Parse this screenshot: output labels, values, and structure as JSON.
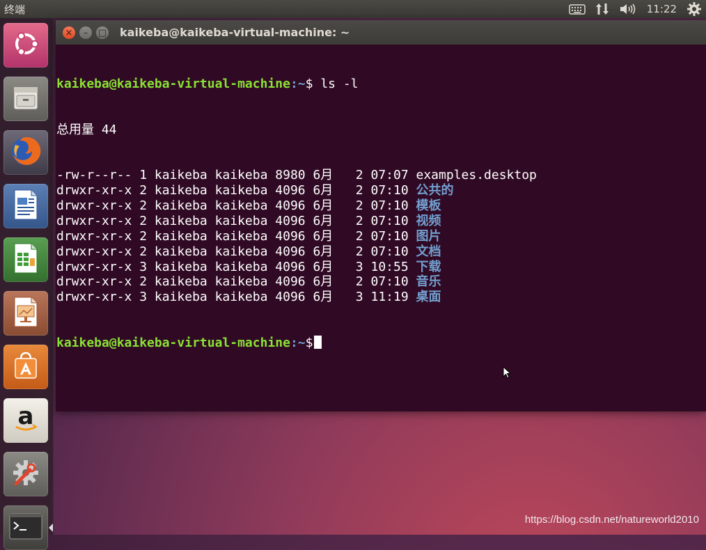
{
  "top_panel": {
    "app_title": "终端",
    "clock": "11:22",
    "icons": [
      "keyboard-icon",
      "network-arrows-icon",
      "volume-icon",
      "settings-gear-icon"
    ]
  },
  "launcher": {
    "items": [
      {
        "name": "ubuntu-dash",
        "icon": "ubuntu-logo-icon"
      },
      {
        "name": "files",
        "icon": "file-cabinet-icon"
      },
      {
        "name": "firefox",
        "icon": "firefox-icon"
      },
      {
        "name": "libreoffice-writer",
        "icon": "writer-document-icon"
      },
      {
        "name": "libreoffice-calc",
        "icon": "calc-spreadsheet-icon"
      },
      {
        "name": "libreoffice-impress",
        "icon": "impress-presentation-icon"
      },
      {
        "name": "ubuntu-software",
        "icon": "software-bag-icon"
      },
      {
        "name": "amazon",
        "icon": "amazon-icon"
      },
      {
        "name": "system-settings",
        "icon": "settings-wrench-icon"
      },
      {
        "name": "terminal",
        "icon": "terminal-icon",
        "active": true
      }
    ]
  },
  "window": {
    "title": "kaikeba@kaikeba-virtual-machine: ~"
  },
  "terminal": {
    "prompt_user_host": "kaikeba@kaikeba-virtual-machine",
    "prompt_path": ":~",
    "prompt_symbol": "$",
    "command": " ls -l",
    "total_line": "总用量 44",
    "entries": [
      {
        "meta": "-rw-r--r-- 1 kaikeba kaikeba 8980 6月   2 07:07 ",
        "name": "examples.desktop",
        "is_dir": false
      },
      {
        "meta": "drwxr-xr-x 2 kaikeba kaikeba 4096 6月   2 07:10 ",
        "name": "公共的",
        "is_dir": true
      },
      {
        "meta": "drwxr-xr-x 2 kaikeba kaikeba 4096 6月   2 07:10 ",
        "name": "模板",
        "is_dir": true
      },
      {
        "meta": "drwxr-xr-x 2 kaikeba kaikeba 4096 6月   2 07:10 ",
        "name": "视频",
        "is_dir": true
      },
      {
        "meta": "drwxr-xr-x 2 kaikeba kaikeba 4096 6月   2 07:10 ",
        "name": "图片",
        "is_dir": true
      },
      {
        "meta": "drwxr-xr-x 2 kaikeba kaikeba 4096 6月   2 07:10 ",
        "name": "文档",
        "is_dir": true
      },
      {
        "meta": "drwxr-xr-x 3 kaikeba kaikeba 4096 6月   3 10:55 ",
        "name": "下载",
        "is_dir": true
      },
      {
        "meta": "drwxr-xr-x 2 kaikeba kaikeba 4096 6月   2 07:10 ",
        "name": "音乐",
        "is_dir": true
      },
      {
        "meta": "drwxr-xr-x 3 kaikeba kaikeba 4096 6月   3 11:19 ",
        "name": "桌面",
        "is_dir": true
      }
    ]
  },
  "colors": {
    "terminal_bg": "#300a24",
    "prompt_user": "#8ae234",
    "prompt_path": "#729fcf",
    "directory": "#729fcf"
  },
  "watermark": "https://blog.csdn.net/natureworld2010"
}
